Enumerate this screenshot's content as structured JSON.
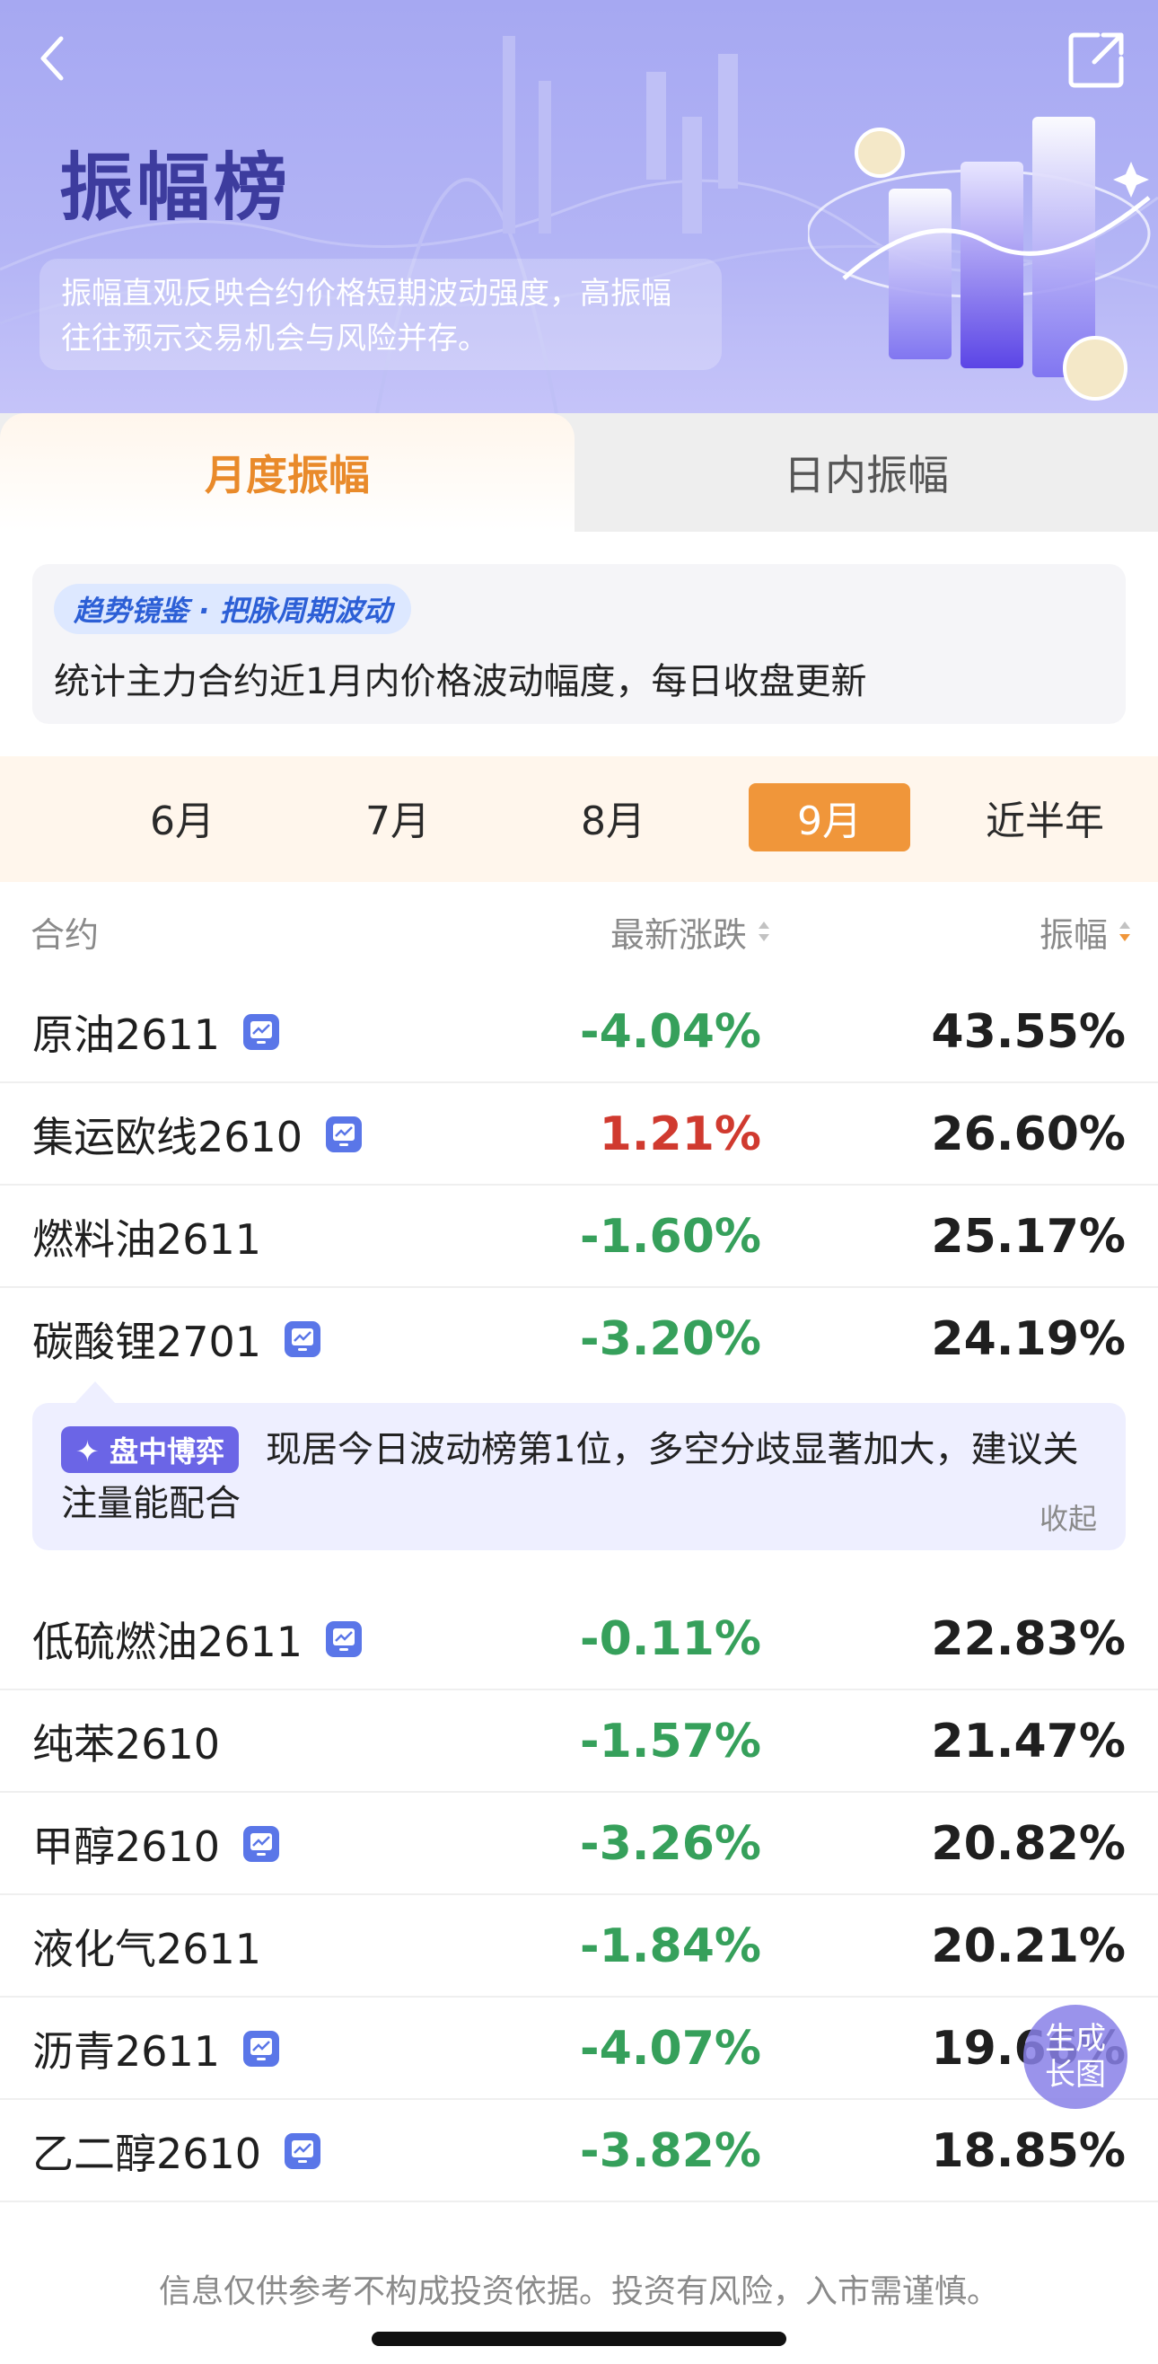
{
  "header": {
    "title": "振幅榜",
    "subtitle": "振幅直观反映合约价格短期波动强度，高振幅往往预示交易机会与风险并存。",
    "back_icon": "chevron-left-icon",
    "share_icon": "share-icon"
  },
  "tabs": [
    {
      "label": "月度振幅",
      "active": true
    },
    {
      "label": "日内振幅",
      "active": false
    }
  ],
  "info_card": {
    "tag": "趋势镜鉴 · 把脉周期波动",
    "text": "统计主力合约近1月内价格波动幅度，每日收盘更新"
  },
  "months": [
    {
      "label": "6月",
      "active": false
    },
    {
      "label": "7月",
      "active": false
    },
    {
      "label": "8月",
      "active": false
    },
    {
      "label": "9月",
      "active": true
    },
    {
      "label": "近半年",
      "active": false
    }
  ],
  "table": {
    "headers": {
      "contract": "合约",
      "change": "最新涨跌",
      "amplitude": "振幅"
    },
    "rows": [
      {
        "name": "原油2611",
        "badge": true,
        "change": "-4.04%",
        "direction": "down",
        "amplitude": "43.55%"
      },
      {
        "name": "集运欧线2610",
        "badge": true,
        "change": "1.21%",
        "direction": "up",
        "amplitude": "26.60%"
      },
      {
        "name": "燃料油2611",
        "badge": false,
        "change": "-1.60%",
        "direction": "down",
        "amplitude": "25.17%"
      },
      {
        "name": "碳酸锂2701",
        "badge": true,
        "change": "-3.20%",
        "direction": "down",
        "amplitude": "24.19%"
      },
      {
        "name": "低硫燃油2611",
        "badge": true,
        "change": "-0.11%",
        "direction": "down",
        "amplitude": "22.83%"
      },
      {
        "name": "纯苯2610",
        "badge": false,
        "change": "-1.57%",
        "direction": "down",
        "amplitude": "21.47%"
      },
      {
        "name": "甲醇2610",
        "badge": true,
        "change": "-3.26%",
        "direction": "down",
        "amplitude": "20.82%"
      },
      {
        "name": "液化气2611",
        "badge": false,
        "change": "-1.84%",
        "direction": "down",
        "amplitude": "20.21%"
      },
      {
        "name": "沥青2611",
        "badge": true,
        "change": "-4.07%",
        "direction": "down",
        "amplitude": "19.66%"
      },
      {
        "name": "乙二醇2610",
        "badge": true,
        "change": "-3.82%",
        "direction": "down",
        "amplitude": "18.85%"
      }
    ]
  },
  "tip": {
    "badge": "✦ 盘中博弈",
    "text": "现居今日波动榜第1位，多空分歧显著加大，建议关注量能配合",
    "collapse": "收起"
  },
  "float_button": {
    "line1": "生成",
    "line2": "长图"
  },
  "footer": {
    "disclaimer": "信息仅供参考不构成投资依据。投资有风险，入市需谨慎。"
  },
  "colors": {
    "up": "#d03a2f",
    "down": "#36a05b",
    "accent": "#f0963a",
    "brand": "#3d3c9e"
  }
}
